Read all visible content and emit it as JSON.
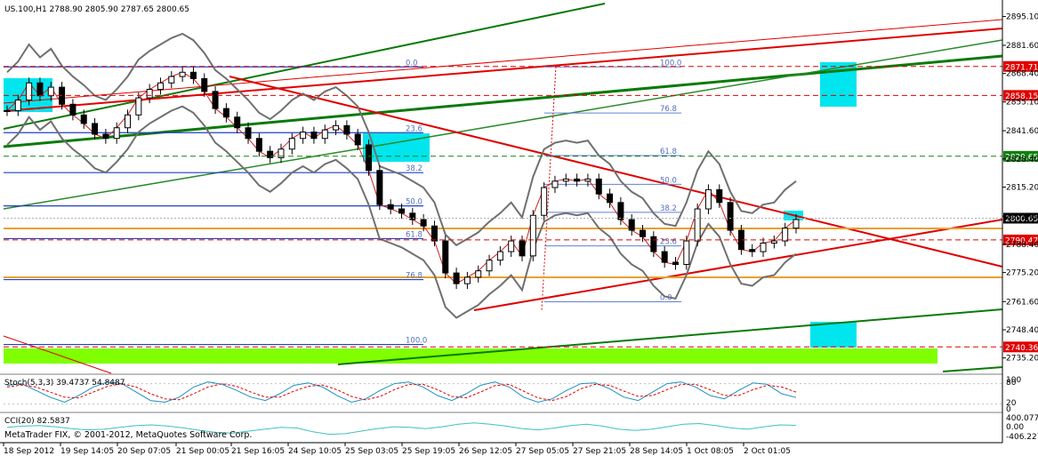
{
  "header": {
    "symbol_line": "US.100,H1  2788.90 2805.90 2787.65 2800.65"
  },
  "copyright": "MetaTrader FIX, © 2001-2012, MetaQuotes Software Corp.",
  "colors": {
    "background": "#ffffff",
    "grid": "#c8c8c8",
    "axis_text": "#000000",
    "red_line": "#e00000",
    "green_line": "#0a7a0a",
    "blue_line": "#2040c0",
    "orange_line": "#e8a030",
    "bb": "#707070",
    "cyan_box": "#00e5ee",
    "green_zone": "#80ff00",
    "stoch_main": "#1e90c0",
    "stoch_signal": "#e00000",
    "cci": "#40c0c0"
  },
  "chart_data": [
    {
      "type": "candlestick",
      "title": "US.100,H1",
      "ohlc_last": {
        "open": 2788.9,
        "high": 2805.9,
        "low": 2787.65,
        "close": 2800.65
      },
      "y_ticks": [
        "2895.10",
        "2881.60",
        "2868.40",
        "2855.10",
        "2841.60",
        "2828.40",
        "2815.20",
        "2801.60",
        "2788.40",
        "2775.20",
        "2761.60",
        "2748.40",
        "2735.20"
      ],
      "y_range": [
        2728,
        2902
      ],
      "x_ticks": [
        "18 Sep 2012",
        "19 Sep 14:05",
        "20 Sep 07:05",
        "21 Sep 00:05",
        "21 Sep 16:05",
        "24 Sep 10:05",
        "25 Sep 03:05",
        "25 Sep 19:05",
        "26 Sep 12:05",
        "27 Sep 05:05",
        "27 Sep 21:05",
        "28 Sep 14:05",
        "1 Oct 08:05",
        "2 Oct 01:05"
      ],
      "price_tags": [
        {
          "label": "2871.71",
          "value": 2871.71,
          "kind": "red"
        },
        {
          "label": "2858.15",
          "value": 2858.15,
          "kind": "red"
        },
        {
          "label": "2829.65",
          "value": 2829.65,
          "kind": "green"
        },
        {
          "label": "2800.65",
          "value": 2800.65,
          "kind": "current"
        },
        {
          "label": "2790.47",
          "value": 2790.47,
          "kind": "red"
        },
        {
          "label": "2740.36",
          "value": 2740.36,
          "kind": "red"
        }
      ],
      "fib_left": [
        {
          "label": "0.0",
          "value": 2871.5
        },
        {
          "label": "23.6",
          "value": 2840.7
        },
        {
          "label": "38.2",
          "value": 2822.0
        },
        {
          "label": "50.0",
          "value": 2806.4
        },
        {
          "label": "61.8",
          "value": 2791.1
        },
        {
          "label": "76.8",
          "value": 2771.9
        },
        {
          "label": "100.0",
          "value": 2741.5
        }
      ],
      "fib_right": [
        {
          "label": "100.0",
          "value": 2871.5
        },
        {
          "label": "76.8",
          "value": 2849.9
        },
        {
          "label": "61.8",
          "value": 2830.0
        },
        {
          "label": "50.0",
          "value": 2816.5
        },
        {
          "label": "38.2",
          "value": 2803.4
        },
        {
          "label": "23.6",
          "value": 2787.7
        },
        {
          "label": "0.0",
          "value": 2761.5
        }
      ],
      "close_series": [
        2851,
        2856,
        2864,
        2858,
        2862,
        2854,
        2849,
        2845,
        2840,
        2838,
        2843,
        2849,
        2857,
        2861,
        2864,
        2867,
        2869,
        2866,
        2860,
        2852,
        2848,
        2843,
        2838,
        2832,
        2829,
        2833,
        2838,
        2841,
        2838,
        2842,
        2844,
        2840,
        2835,
        2823,
        2807,
        2805,
        2803,
        2800,
        2797,
        2790,
        2775,
        2770,
        2773,
        2776,
        2781,
        2785,
        2790,
        2783,
        2802,
        2815,
        2818,
        2819,
        2818,
        2819,
        2812,
        2808,
        2800,
        2795,
        2792,
        2785,
        2780,
        2779,
        2790,
        2805,
        2814,
        2808,
        2795,
        2786,
        2785,
        2789,
        2790,
        2796,
        2800
      ]
    },
    {
      "type": "line",
      "title": "Stoch(5,3,3) 39.4737 54.8487",
      "y_ticks": [
        "100",
        "80",
        "20",
        "0"
      ],
      "series": [
        {
          "name": "main",
          "values": [
            75,
            80,
            60,
            40,
            25,
            45,
            70,
            85,
            80,
            55,
            30,
            25,
            40,
            70,
            85,
            78,
            60,
            40,
            30,
            50,
            75,
            82,
            70,
            45,
            25,
            35,
            60,
            80,
            85,
            70,
            45,
            30,
            50,
            75,
            85,
            70,
            40,
            25,
            35,
            60,
            80,
            82,
            65,
            40,
            30,
            55,
            80,
            85,
            70,
            45,
            35,
            60,
            82,
            78,
            50,
            39
          ]
        },
        {
          "name": "signal",
          "values": [
            70,
            76,
            70,
            55,
            40,
            38,
            55,
            72,
            80,
            70,
            50,
            35,
            32,
            50,
            70,
            80,
            72,
            55,
            40,
            40,
            58,
            72,
            76,
            62,
            42,
            32,
            42,
            62,
            78,
            78,
            62,
            42,
            38,
            55,
            74,
            78,
            58,
            38,
            30,
            42,
            65,
            78,
            75,
            58,
            42,
            45,
            62,
            78,
            78,
            62,
            45,
            45,
            62,
            75,
            70,
            55
          ]
        }
      ]
    },
    {
      "type": "line",
      "title": "CCI(20) 82.5837",
      "y_ticks": [
        "400.077",
        "0.00",
        "-406.227"
      ],
      "series": [
        {
          "name": "CCI",
          "values": [
            20,
            60,
            80,
            40,
            -20,
            -60,
            -40,
            20,
            80,
            100,
            60,
            0,
            -80,
            -140,
            -160,
            -100,
            -40,
            20,
            0,
            -120,
            -200,
            -180,
            -100,
            -20,
            40,
            20,
            -20,
            40,
            120,
            160,
            120,
            60,
            -20,
            -60,
            0,
            80,
            120,
            60,
            -40,
            -80,
            -40,
            40,
            120,
            140,
            80,
            0,
            -40,
            40,
            100,
            82
          ]
        }
      ]
    }
  ]
}
